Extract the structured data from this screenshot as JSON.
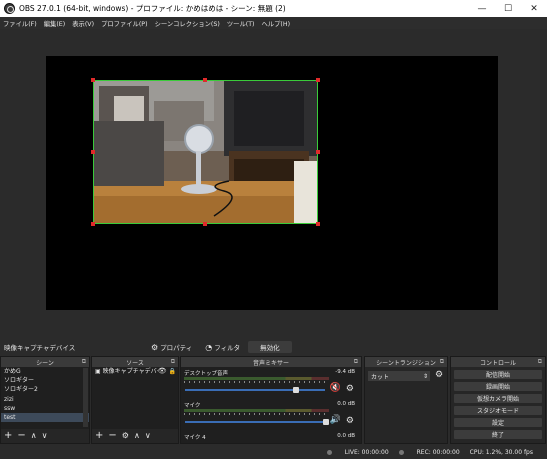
{
  "window": {
    "title": "OBS 27.0.1 (64-bit, windows) - プロファイル: かめはめは - シーン: 無題 (2)",
    "minimize": "—",
    "maximize": "☐",
    "close": "✕"
  },
  "menu": [
    "ファイル(F)",
    "編集(E)",
    "表示(V)",
    "プロファイル(P)",
    "シーンコレクション(S)",
    "ツール(T)",
    "ヘルプ(H)"
  ],
  "source_toolbar": {
    "source_name": "映像キャプチャデバイス",
    "properties_label": "プロパティ",
    "filters_label": "フィルタ",
    "deactivate_label": "無効化"
  },
  "docks": {
    "scenes": {
      "title": "シーン",
      "items": [
        "かめG",
        "ソロギター",
        "ソロギター2",
        "zizi",
        "ssw",
        "test"
      ],
      "selected_index": 5
    },
    "sources": {
      "title": "ソース",
      "items": [
        "映像キャプチャデバイス"
      ]
    },
    "mixer": {
      "title": "音声ミキサー",
      "channels": [
        {
          "label": "デスクトップ音声",
          "db": "-9.4 dB",
          "volume": 0.75,
          "muted": true
        },
        {
          "label": "マイク",
          "db": "0.0 dB",
          "volume": 1.0,
          "muted": false
        },
        {
          "label": "マイク 4",
          "db": "0.0 dB",
          "volume": 1.0,
          "muted": false
        }
      ]
    },
    "transitions": {
      "title": "シーントランジション",
      "selected": "カット"
    },
    "controls": {
      "title": "コントロール",
      "buttons": [
        "配信開始",
        "録画開始",
        "仮想カメラ開始",
        "スタジオモード",
        "設定",
        "終了"
      ]
    }
  },
  "status": {
    "live": "LIVE: 00:00:00",
    "rec": "REC: 00:00:00",
    "cpu": "CPU: 1.2%, 30.00 fps"
  },
  "colors": {
    "accent": "#3a6db5",
    "selection_border": "#3acb3a",
    "handle": "#e02a2a",
    "muted": "#d13a3a"
  }
}
